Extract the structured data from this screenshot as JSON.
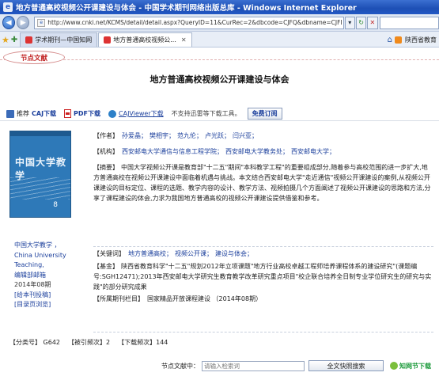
{
  "window": {
    "title": "地方普通高校视频公开课建设与体会 - 中国学术期刊网络出版总库 - Windows Internet Explorer"
  },
  "address_bar": {
    "url": "http://www.cnki.net/KCMS/detail/detail.aspx?QueryID=11&CurRec=2&dbcode=CJFQ&dbname=CJFI",
    "icons": [
      "back-arrow",
      "forward-arrow",
      "dropdown",
      "refresh",
      "stop"
    ]
  },
  "tabs": [
    {
      "label": "学术期刊—中国知网",
      "active": false
    },
    {
      "label": "地方普通高校视频公...",
      "active": true
    }
  ],
  "tab_right": {
    "label": "陕西省教育"
  },
  "page": {
    "section_label": "节点文献",
    "article_title": "地方普通高校视频公开课建设与体会",
    "download_bar": {
      "recommend": "推荐",
      "caj_download": "CAJ下载",
      "pdf_download": "PDF下载",
      "cajviewer": "CAJViewer下载",
      "unsupported_note": "不支持迅雷等下载工具。",
      "free_subscribe": "免费订阅"
    },
    "cover": {
      "title": "中国大学教学",
      "issue": "8"
    },
    "journal_info": {
      "name_cn": "中国大学教学 ，",
      "name_en_1": "China University",
      "name_en_2": "Teaching,",
      "editor": "编辑部邮箱",
      "issue": "2014年08期",
      "submit": "[给本刊投稿]",
      "toc": "[目录页浏览]"
    },
    "authors": {
      "label": "【作者】",
      "names": [
        "孙爱晶；",
        "樊相宇；",
        "范九伦；",
        "卢光跃；",
        "闫兴亚；"
      ]
    },
    "institutions": {
      "label": "【机构】",
      "names": [
        "西安邮电大学通信与信息工程学院；",
        "西安邮电大学教务处；",
        "西安邮电大学；"
      ]
    },
    "abstract": {
      "label": "【摘要】",
      "text": "中国大学视频公开课是教育部\"十二五\"期间\"本科教学工程\"的重要组成部分,随着参与高校范围的进一步扩大,地方普通高校在视频公开课建设中面临着机遇与挑战。本文结合西安邮电大学\"走近通信\"视频公开课建设的案例,从视频公开课建设的目标定位、课程的选题、教学内容的设计、教学方法、视频拍摄几个方面阐述了视频公开课建设的思路和方法,分享了课程建设的体会,力求为我国地方普通高校的视频公开课建设提供借鉴和参考。"
    },
    "keywords": {
      "label": "【关键词】",
      "words": [
        "地方普通高校；",
        "视频公开课；",
        "建设与体会；"
      ]
    },
    "fund": {
      "label": "【基金】",
      "text": "陕西省教育科学\"十二五\"规划2012年立项课题\"地方行业高校卓越工程师培养课程体系的建设研究\"(课题编号:SGH12471);2013年西安邮电大学研究生教育教学改革研究重点项目\"校企联合培养全日制专业学位研究生的研究与实践\"的部分研究成果"
    },
    "column": {
      "label": "【所属期刊栏目】",
      "value": "国家精品开放课程建设 （2014年08期）"
    },
    "stats": {
      "classification": "【分类号】 G642",
      "cited": "【被引频次】2",
      "downloads": "【下载频次】144"
    },
    "search": {
      "label": "节点文献中：",
      "placeholder": "请输入检索词",
      "button": "全文快照搜索",
      "knowledge_node": "知网节下载"
    }
  }
}
